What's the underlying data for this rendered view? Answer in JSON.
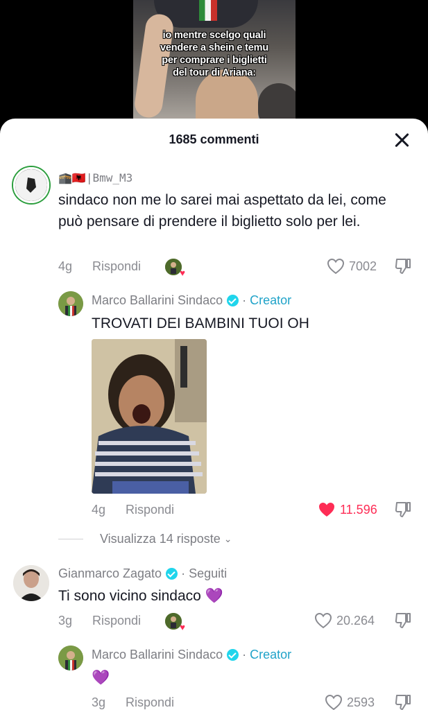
{
  "video": {
    "caption": "io mentre  scelgo quali\nvendere a shein e temu\nper comprare i biglietti\ndel tour di Ariana:"
  },
  "header": {
    "title": "1685 commenti",
    "close_icon": "close-icon"
  },
  "comments": [
    {
      "username": "🕋🇦🇱|Bmw_M3",
      "text": "sindaco non me lo sarei mai aspettato da lei, come può pensare di prendere il biglietto solo per lei.",
      "time": "4g",
      "reply": "Rispondi",
      "likes": "7002",
      "liked": false,
      "creator_liked": true
    },
    {
      "username": "Marco Ballarini Sindaco",
      "verified": true,
      "dot": "·",
      "badge": "Creator",
      "text": "TROVATI DEI BAMBINI TUOI OH",
      "time": "4g",
      "reply": "Rispondi",
      "likes": "11.596",
      "liked": true,
      "view_replies": "Visualizza 14 risposte"
    },
    {
      "username": "Gianmarco Zagato",
      "verified": true,
      "dot": "·",
      "badge": "Seguiti",
      "text": "Ti sono vicino sindaco 💜",
      "time": "3g",
      "reply": "Rispondi",
      "likes": "20.264",
      "liked": false,
      "creator_liked": true
    },
    {
      "username": "Marco Ballarini Sindaco",
      "verified": true,
      "dot": "·",
      "badge": "Creator",
      "text": "💜",
      "time": "3g",
      "reply": "Rispondi",
      "likes": "2593",
      "liked": false
    }
  ],
  "colors": {
    "accent_creator": "#20a3c9",
    "verified": "#20d5ec",
    "like_red": "#fe2c55",
    "text": "#161823",
    "muted": "#8a8b91"
  }
}
